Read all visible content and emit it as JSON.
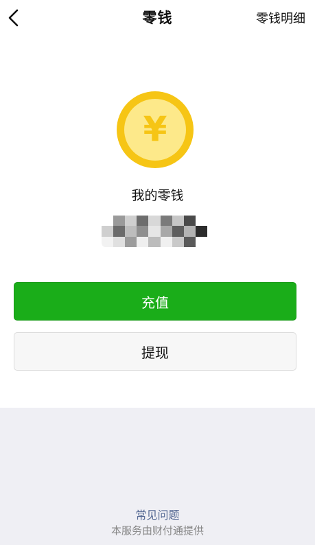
{
  "nav": {
    "title": "零钱",
    "right_link": "零钱明细",
    "back_icon": "chevron-left-icon"
  },
  "wallet": {
    "coin_icon": "yen-coin-icon",
    "coin_symbol": "¥",
    "label": "我的零钱",
    "balance_masked": true
  },
  "actions": {
    "recharge_label": "充值",
    "withdraw_label": "提现"
  },
  "footer": {
    "faq_link": "常见问题",
    "provider_text": "本服务由财付通提供"
  },
  "colors": {
    "primary_green": "#1aad19",
    "coin_outer": "#f6c515",
    "coin_inner": "#fde98a",
    "link_blue": "#576b95",
    "footer_bg": "#efeff4"
  }
}
